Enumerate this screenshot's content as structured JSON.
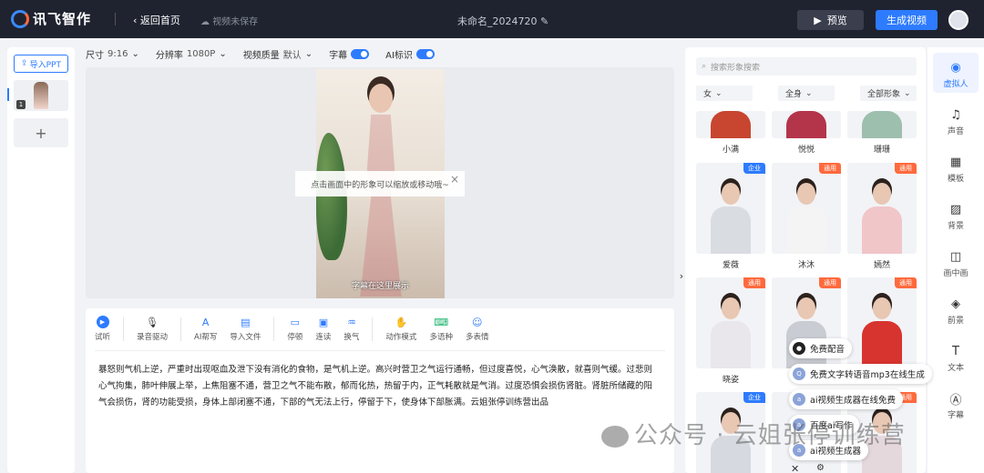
{
  "topbar": {
    "logo": "讯飞智作",
    "back": "返回首页",
    "save_state": "视频未保存",
    "doc_title": "未命名_2024720",
    "preview": "预览",
    "generate": "生成视频"
  },
  "left": {
    "import": "导入PPT",
    "slide_num": "1",
    "add": "+"
  },
  "settings": {
    "size_label": "尺寸",
    "size_value": "9:16",
    "res_label": "分辨率",
    "res_value": "1080P",
    "quality_label": "视频质量",
    "quality_value": "默认",
    "subtitle_label": "字幕",
    "ai_label": "AI标识"
  },
  "canvas": {
    "tip": "点击画面中的形象可以缩放或移动哦~",
    "subtitle": "字幕在这里展示"
  },
  "editor": {
    "tools": [
      {
        "label": "试听"
      },
      {
        "label": "录音驱动"
      },
      {
        "label": "AI帮写"
      },
      {
        "label": "导入文件"
      },
      {
        "label": "停顿"
      },
      {
        "label": "连读"
      },
      {
        "label": "换气"
      },
      {
        "label": "动作模式"
      },
      {
        "label": "多语种"
      },
      {
        "label": "多表情"
      }
    ],
    "text": "暴怒则气机上逆，严重时出现呕血及泄下没有消化的食物，是气机上逆。高兴时营卫之气运行通畅，但过度喜悦，心气涣散，就喜则气缓。过悲则心气拘集，肺叶伸展上举，上焦阻塞不通，营卫之气不能布散，郁而化热，热留于内，正气耗散就是气消。过度恐惧会损伤肾脏。肾脏所储藏的阳气会损伤，肾的功能受损，身体上部闭塞不通，下部的气无法上行，停留于下，使身体下部胀满。云姐张停训练营出品"
  },
  "avatars": {
    "search_placeholder": "搜索形象搜索",
    "filters": [
      "女",
      "全身",
      "全部形象"
    ],
    "row1_names": [
      "小满",
      "悦悦",
      "珊珊"
    ],
    "row2": [
      {
        "name": "爱薇",
        "badge": "企业"
      },
      {
        "name": "沐沐",
        "badge": "通用"
      },
      {
        "name": "嫣然",
        "badge": "通用"
      }
    ],
    "row3": [
      {
        "name": "晓姿",
        "badge": "通用"
      },
      {
        "name": "",
        "badge": "通用"
      },
      {
        "name": "",
        "badge": "通用"
      }
    ],
    "row4_badges": [
      "企业",
      "通用",
      "通用"
    ]
  },
  "side_nav": [
    "虚拟人",
    "声音",
    "模板",
    "背景",
    "画中画",
    "前景",
    "文本",
    "字幕"
  ],
  "popup": {
    "item1": "免费配音",
    "item2": "免费文字转语音mp3在线生成",
    "item3": "ai视频生成器在线免费",
    "item4": "百度ai写作",
    "item5": "ai视频生成器"
  },
  "watermark": "公众号 · 云姐张停训练营"
}
